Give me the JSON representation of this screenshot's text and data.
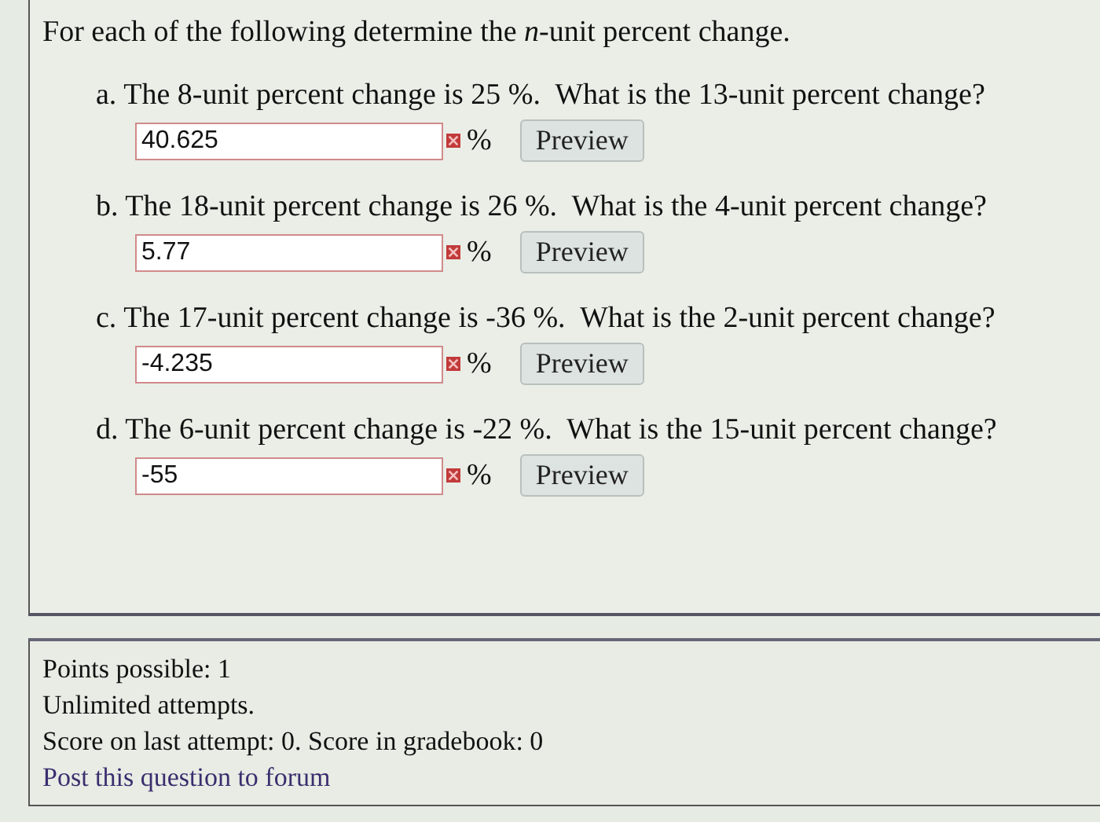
{
  "question": {
    "prompt": "For each of the following determine the *n*-unit percent change.",
    "parts": [
      {
        "text": "a. The 8-unit percent change is 25 %.  What is the 13-unit percent change?",
        "value": "40.625",
        "correct": false,
        "unit": "%",
        "button": "Preview"
      },
      {
        "text": "b. The 18-unit percent change is 26 %.  What is the 4-unit percent change?",
        "value": "5.77",
        "correct": false,
        "unit": "%",
        "button": "Preview"
      },
      {
        "text": "c. The 17-unit percent change is -36 %.  What is the 2-unit percent change?",
        "value": "-4.235",
        "correct": false,
        "unit": "%",
        "button": "Preview"
      },
      {
        "text": "d. The 6-unit percent change is -22 %.  What is the 15-unit percent change?",
        "value": "-55",
        "correct": false,
        "unit": "%",
        "button": "Preview"
      }
    ]
  },
  "info": {
    "lines": [
      "Points possible: 1",
      "Unlimited attempts.",
      "Score on last attempt: 0. Score in gradebook: 0"
    ],
    "link": "Post this question to forum"
  }
}
